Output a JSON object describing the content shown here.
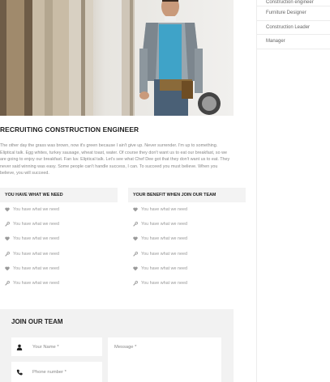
{
  "sidebar": {
    "items": [
      {
        "label": "Construction engineer"
      },
      {
        "label": "Furniture Designer"
      },
      {
        "label": "Construction Leader"
      },
      {
        "label": "Manager"
      }
    ]
  },
  "job": {
    "title": "RECRUITING CONSTRUCTION ENGINEER",
    "description": "The other day the grass was brown, now it's green because I ain't give up. Never surrender. I'm up to something. Eliptical talk. Egg whites, turkey sausage, wheat toast, water. Of course they don't want us to eat our breakfast, so we are going to enjoy our breakfast. Fan luv. Eliptical talk. Let's see what Chef Dee got that they don't want us to eat. They never said winning was easy. Some people can't handle success, I can. To succeed you must believe. When you believe, you will succeed."
  },
  "needs": {
    "header": "YOU HAVE WHAT WE NEED",
    "items": [
      {
        "icon": "heart-icon",
        "text": "You have what we need"
      },
      {
        "icon": "wrench-icon",
        "text": "You have what we need"
      },
      {
        "icon": "heart-icon",
        "text": "You have what we need"
      },
      {
        "icon": "wrench-icon",
        "text": "You have what we need"
      },
      {
        "icon": "heart-icon",
        "text": "You have what we need"
      },
      {
        "icon": "wrench-icon",
        "text": "You have what we need"
      }
    ]
  },
  "benefits": {
    "header": "YOUR BENEFIT WHEN JOIN OUR TEAM",
    "items": [
      {
        "icon": "heart-icon",
        "text": "You have what we need"
      },
      {
        "icon": "wrench-icon",
        "text": "You have what we need"
      },
      {
        "icon": "heart-icon",
        "text": "You have what we need"
      },
      {
        "icon": "wrench-icon",
        "text": "You have what we need"
      },
      {
        "icon": "heart-icon",
        "text": "You have what we need"
      },
      {
        "icon": "wrench-icon",
        "text": "You have what we need"
      }
    ]
  },
  "join": {
    "title": "JOIN OUR TEAM",
    "name_placeholder": "Your Name *",
    "phone_placeholder": "Phone number *",
    "message_placeholder": "Message *"
  }
}
